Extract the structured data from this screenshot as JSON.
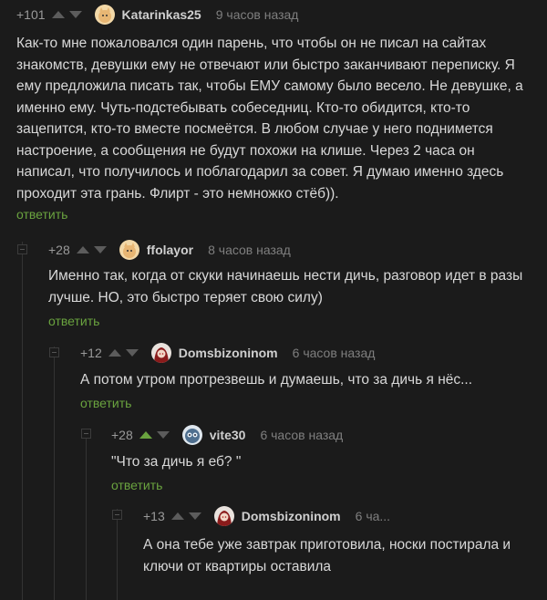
{
  "comments": [
    {
      "rating": "+101",
      "author": "Katarinkas25",
      "time": "9 часов назад",
      "text": "Как-то мне пожаловался один парень, что чтобы он не писал на сайтах знакомств, девушки ему не отвечают или быстро заканчивают переписку. Я ему предложила писать так, чтобы ЕМУ самому было весело. Не девушке, а именно ему.  Чуть-подстебывать собеседниц. Кто-то обидится, кто-то зацепится, кто-то вместе посмеётся. В любом случае у него поднимется настроение, а сообщения не будут похожи на клише. Через 2 часа он написал, что получилось и поблагодарил за совет. Я думаю именно здесь проходит эта грань. Флирт - это немножко стёб)).",
      "reply": "ответить",
      "avatar": "avatar-cat-icon"
    },
    {
      "rating": "+28",
      "author": "ffolayor",
      "time": "8 часов назад",
      "text": "Именно так, когда от скуки начинаешь нести дичь, разговор идет в разы лучше. НО, это быстро теряет свою силу)",
      "reply": "ответить",
      "avatar": "avatar-cat-icon"
    },
    {
      "rating": "+12",
      "author": "Domsbizoninom",
      "time": "6 часов назад",
      "text": "А потом утром протрезвешь и думаешь, что за дичь я нёс...",
      "reply": "ответить",
      "avatar": "avatar-anime-icon"
    },
    {
      "rating": "+28",
      "author": "vite30",
      "time": "6 часов назад",
      "text": "\"Что за дичь я еб? \"",
      "reply": "ответить",
      "avatar": "avatar-robot-icon",
      "upvoted": true
    },
    {
      "rating": "+13",
      "author": "Domsbizoninom",
      "time": "6 ча...",
      "text": "А она тебе уже завтрак приготовила, носки постирала и ключи от квартиры оставила",
      "avatar": "avatar-anime-icon"
    }
  ],
  "colors": {
    "background": "#1b1b1b",
    "reply_link": "#6aa33f",
    "upvote_active": "#6aa33f"
  }
}
